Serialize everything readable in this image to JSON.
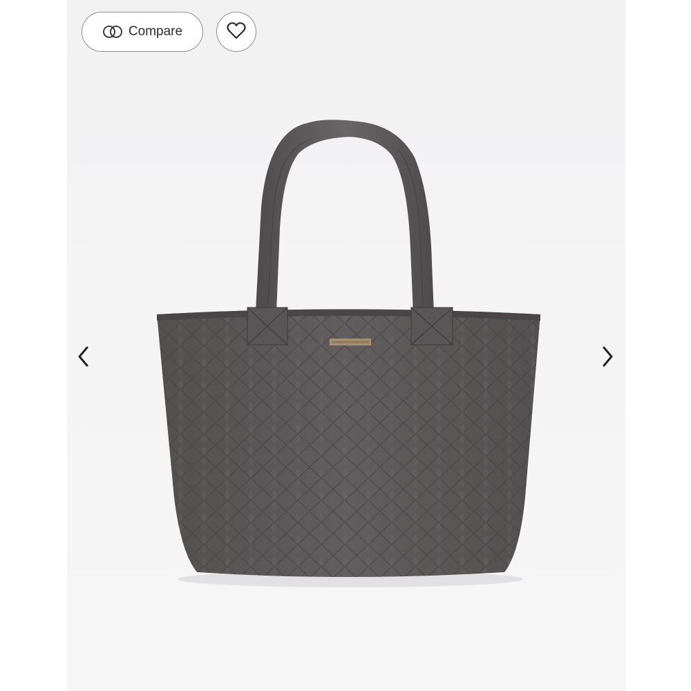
{
  "toolbar": {
    "compare_label": "Compare",
    "compare_icon": "compare-rings-icon",
    "favorite_icon": "heart-icon"
  },
  "gallery": {
    "prev_icon": "chevron-left-icon",
    "next_icon": "chevron-right-icon",
    "product_image": "quilted-tote-bag",
    "bag_color": "#5f5a5b"
  }
}
